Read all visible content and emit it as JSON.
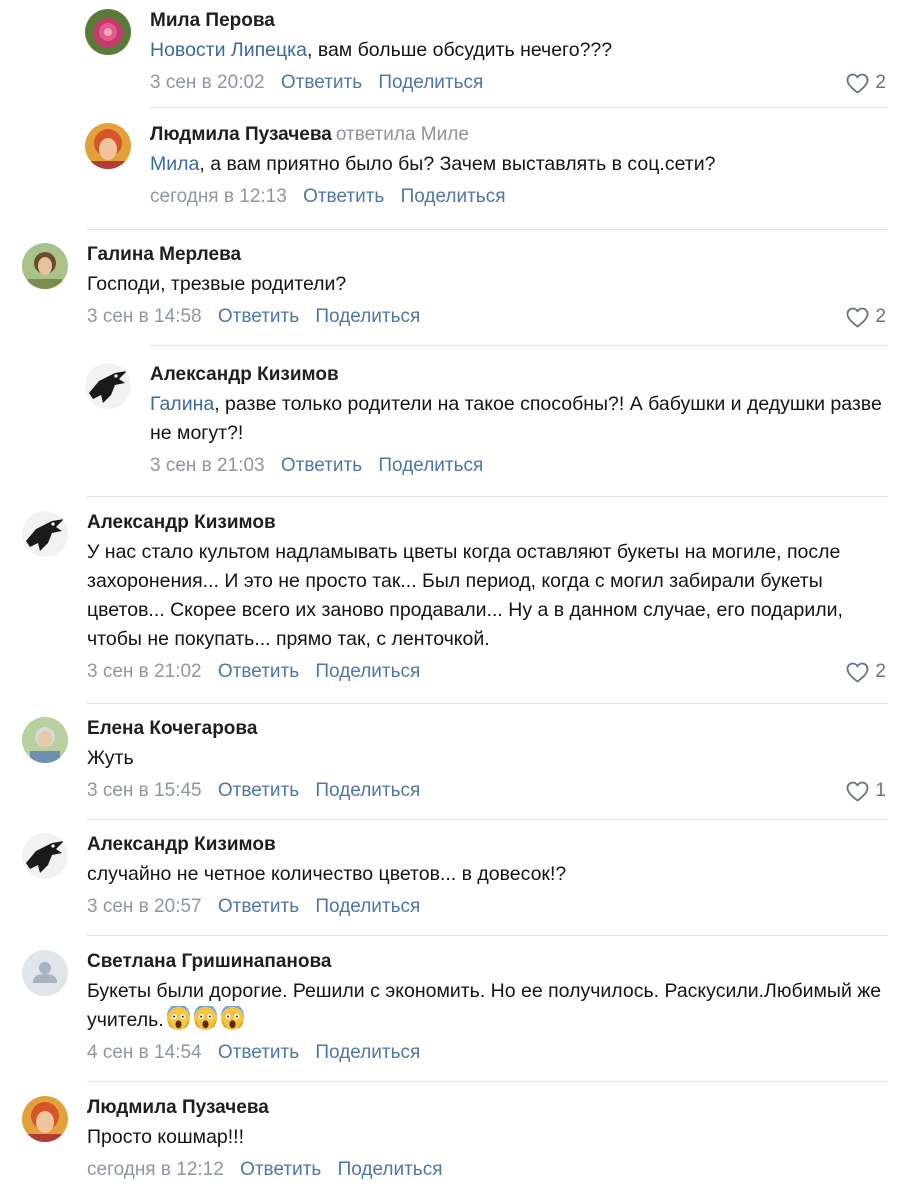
{
  "comments": [
    {
      "author": "Мила Перова",
      "replied_to": "",
      "mention": "Новости Липецка",
      "text": ", вам больше обсудить нечего???",
      "date": "3 сен в 20:02",
      "reply_label": "Ответить",
      "share_label": "Поделиться",
      "likes": "2"
    },
    {
      "author": "Людмила Пузачева",
      "replied_to": "ответила Миле",
      "mention": "Мила",
      "text": ", а вам приятно было бы? Зачем выставлять в соц.сети?",
      "date": "сегодня в 12:13",
      "reply_label": "Ответить",
      "share_label": "Поделиться",
      "likes": ""
    },
    {
      "author": "Галина Мерлева",
      "replied_to": "",
      "mention": "",
      "text": "Господи, трезвые родители?",
      "date": "3 сен в 14:58",
      "reply_label": "Ответить",
      "share_label": "Поделиться",
      "likes": "2"
    },
    {
      "author": "Александр Кизимов",
      "replied_to": "",
      "mention": "Галина",
      "text": ", разве только родители на такое способны?! А бабушки и дедушки разве не могут?!",
      "date": "3 сен в 21:03",
      "reply_label": "Ответить",
      "share_label": "Поделиться",
      "likes": ""
    },
    {
      "author": "Александр Кизимов",
      "replied_to": "",
      "mention": "",
      "text": "У нас стало культом надламывать цветы когда оставляют букеты на могиле, после захоронения... И это не просто так... Был период, когда с могил забирали букеты цветов... Скорее всего их заново продавали... Ну а в данном случае, его подарили, чтобы не покупать... прямо так, с ленточкой.",
      "date": "3 сен в 21:02",
      "reply_label": "Ответить",
      "share_label": "Поделиться",
      "likes": "2"
    },
    {
      "author": "Елена Кочегарова",
      "replied_to": "",
      "mention": "",
      "text": "Жуть",
      "date": "3 сен в 15:45",
      "reply_label": "Ответить",
      "share_label": "Поделиться",
      "likes": "1"
    },
    {
      "author": "Александр Кизимов",
      "replied_to": "",
      "mention": "",
      "text": "случайно не четное количество цветов... в довесок!?",
      "date": "3 сен в 20:57",
      "reply_label": "Ответить",
      "share_label": "Поделиться",
      "likes": ""
    },
    {
      "author": "Светлана Гришинапанова",
      "replied_to": "",
      "mention": "",
      "text": "Букеты были дорогие. Решили с экономить. Но ее получилось. Раскусили.Любимый же учитель.",
      "emoji": "screaming-face-emoji",
      "date": "4 сен в 14:54",
      "reply_label": "Ответить",
      "share_label": "Поделиться",
      "likes": ""
    },
    {
      "author": "Людмила Пузачева",
      "replied_to": "",
      "mention": "",
      "text": "Просто кошмар!!!",
      "date": "сегодня в 12:12",
      "reply_label": "Ответить",
      "share_label": "Поделиться",
      "likes": ""
    }
  ],
  "colors": {
    "link": "#4f76a4",
    "mention": "#3a6a9c",
    "meta": "#8f96a0",
    "divider": "#dfe2e7"
  },
  "icons": {
    "like": "heart-outline-icon",
    "placeholder_avatar": "user-silhouette-icon"
  }
}
